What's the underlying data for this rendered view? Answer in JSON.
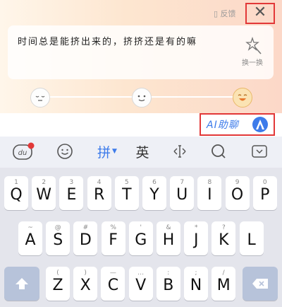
{
  "panel": {
    "feedback_label": "▯ 反馈",
    "sentence": "时间总是能挤出来的，挤挤还是有的嘛",
    "swap_label": "换一换"
  },
  "ai_row": {
    "label": "AI助聊"
  },
  "toolbar": {
    "du_label": "du",
    "pinyin_label": "拼",
    "english_label": "英"
  },
  "keyboard": {
    "row1": [
      {
        "sub": "1",
        "key": "Q"
      },
      {
        "sub": "2",
        "key": "W"
      },
      {
        "sub": "3",
        "key": "E"
      },
      {
        "sub": "4",
        "key": "R"
      },
      {
        "sub": "5",
        "key": "T"
      },
      {
        "sub": "6",
        "key": "Y"
      },
      {
        "sub": "7",
        "key": "U"
      },
      {
        "sub": "8",
        "key": "I"
      },
      {
        "sub": "9",
        "key": "O"
      },
      {
        "sub": "0",
        "key": "P"
      }
    ],
    "row2": [
      {
        "sub": "~",
        "key": "A"
      },
      {
        "sub": "@",
        "key": "S"
      },
      {
        "sub": "#",
        "key": "D"
      },
      {
        "sub": "%",
        "key": "F"
      },
      {
        "sub": "'",
        "key": "G"
      },
      {
        "sub": "&",
        "key": "H"
      },
      {
        "sub": "*",
        "key": "J"
      },
      {
        "sub": "?",
        "key": "K"
      },
      {
        "sub": "",
        "key": "L"
      }
    ],
    "row3": [
      {
        "sub": "(",
        "key": "Z"
      },
      {
        "sub": ")",
        "key": "X"
      },
      {
        "sub": "—",
        "key": "C"
      },
      {
        "sub": "…",
        "key": "V"
      },
      {
        "sub": ":",
        "key": "B"
      },
      {
        "sub": ";",
        "key": "N"
      },
      {
        "sub": "/",
        "key": "M"
      }
    ]
  },
  "colors": {
    "accent": "#3d7bea",
    "highlight_box": "#e23838"
  }
}
